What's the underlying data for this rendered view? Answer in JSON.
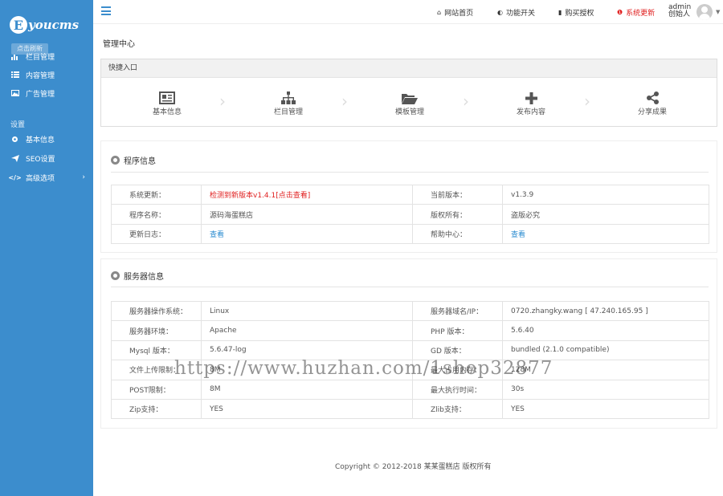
{
  "sidebar": {
    "logo_letter": "E",
    "logo_text": "youcms",
    "ghost_label": "点击刷新",
    "items": [
      {
        "label": "栏目管理",
        "icon": "bar-chart-icon"
      },
      {
        "label": "内容管理",
        "icon": "list-icon"
      },
      {
        "label": "广告管理",
        "icon": "image-icon"
      }
    ],
    "section": "设置",
    "settings": [
      {
        "label": "基本信息",
        "icon": "gear-icon"
      },
      {
        "label": "SEO设置",
        "icon": "send-icon"
      },
      {
        "label": "高级选项",
        "icon": "code-icon"
      }
    ],
    "chevron": "›"
  },
  "topbar": {
    "home": "网站首页",
    "features": "功能开关",
    "buy": "购买授权",
    "update": "系统更新",
    "user_name": "admin",
    "user_role": "创始人"
  },
  "page_title": "管理中心",
  "quick": {
    "title": "快捷入口",
    "items": [
      {
        "label": "基本信息",
        "icon": "newspaper-icon"
      },
      {
        "label": "栏目管理",
        "icon": "sitemap-icon"
      },
      {
        "label": "模板管理",
        "icon": "folder-open-icon"
      },
      {
        "label": "发布内容",
        "icon": "plus-icon"
      },
      {
        "label": "分享成果",
        "icon": "share-icon"
      }
    ]
  },
  "program": {
    "title": "程序信息",
    "rows": [
      {
        "k1": "系统更新：",
        "v1": "检测到新版本v1.4.1[点击查看]",
        "k2": "当前版本：",
        "v2": "v1.3.9"
      },
      {
        "k1": "程序名称：",
        "v1": "源码海蛋糕店",
        "k2": "版权所有：",
        "v2": "盗版必究"
      },
      {
        "k1": "更新日志：",
        "v1": "查看",
        "k2": "帮助中心：",
        "v2": "查看"
      }
    ]
  },
  "server": {
    "title": "服务器信息",
    "rows": [
      {
        "k1": "服务器操作系统：",
        "v1": "Linux",
        "k2": "服务器域名/IP：",
        "v2": "0720.zhangky.wang [ 47.240.165.95 ]"
      },
      {
        "k1": "服务器环境：",
        "v1": "Apache",
        "k2": "PHP 版本：",
        "v2": "5.6.40"
      },
      {
        "k1": "Mysql 版本：",
        "v1": "5.6.47-log",
        "k2": "GD 版本：",
        "v2": "bundled (2.1.0 compatible)"
      },
      {
        "k1": "文件上传限制：",
        "v1": "8M",
        "k2": "最大占用内存：",
        "v2": "128M"
      },
      {
        "k1": "POST限制：",
        "v1": "8M",
        "k2": "最大执行时间：",
        "v2": "30s"
      },
      {
        "k1": "Zip支持：",
        "v1": "YES",
        "k2": "Zlib支持：",
        "v2": "YES"
      }
    ]
  },
  "footer": "Copyright © 2012-2018 某某蛋糕店 版权所有",
  "watermark": "https://www.huzhan.com/1shop32877",
  "colors": {
    "sidebar": "#3c8dcd",
    "alert": "#e02020",
    "link": "#2a8bd0"
  }
}
